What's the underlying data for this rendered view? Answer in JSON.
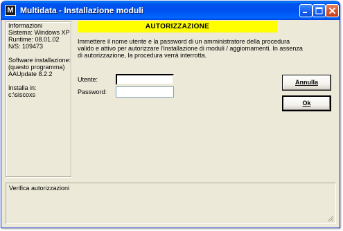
{
  "window": {
    "title": "Multidata - Installazione moduli",
    "icon_letter": "M",
    "controls": [
      "minimize-icon",
      "maximize-icon",
      "close-icon"
    ]
  },
  "info": {
    "header": "Informazioni",
    "system": "Sistema: Windows XP",
    "runtime": "Runtime: 08.01.02",
    "serial": "N/S: 109473",
    "software_label": "Software installazione:",
    "software_note": "(questo programma)",
    "software_version": "AAUpdate 8.2.2",
    "install_label": "Installa in:",
    "install_path": "c:\\siscoxs"
  },
  "banner": {
    "text": "AUTORIZZAZIONE",
    "color": "#ffff00"
  },
  "description": {
    "line1": "Immettere il nome utente e la password di un amministratore della procedura",
    "line2": "valido e attivo per autorizzare l'installazione di moduli / aggiornamenti. In assenza",
    "line3": "di autorizzazione, la procedura verrà interrotta."
  },
  "form": {
    "user_label": "Utente:",
    "user_value": "",
    "password_label": "Password:",
    "password_value": ""
  },
  "buttons": {
    "cancel_label": "Annulla",
    "ok_label": "Ok"
  },
  "status": {
    "text": "Verifica autorizzazioni"
  }
}
